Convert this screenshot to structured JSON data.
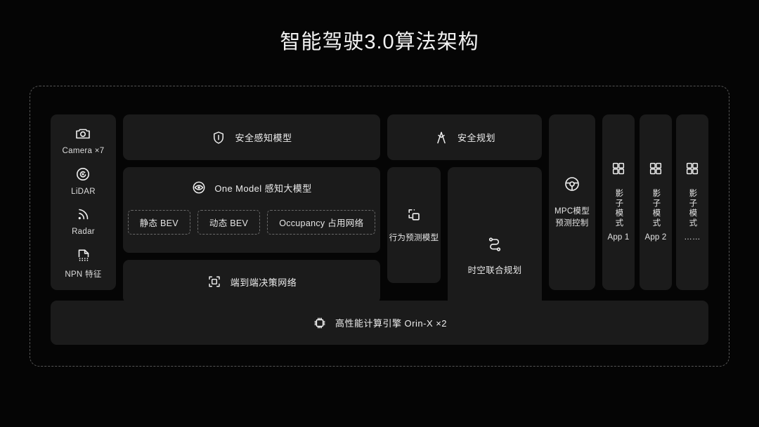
{
  "title": "智能驾驶3.0算法架构",
  "colors": {
    "background": "#050505",
    "card": "#1b1b1b",
    "text": "#ededed",
    "frame_border": "#555555",
    "chip_border": "#6a6a6a"
  },
  "sensors": {
    "name": "sensor-column",
    "items": [
      {
        "icon": "camera-icon",
        "label": "Camera ×7"
      },
      {
        "icon": "lidar-icon",
        "label": "LiDAR"
      },
      {
        "icon": "radar-icon",
        "label": "Radar"
      },
      {
        "icon": "npn-map-icon",
        "label": "NPN 特征"
      }
    ]
  },
  "blocks": {
    "safety_perception": {
      "icon": "shield-icon",
      "label": "安全感知模型"
    },
    "safety_planning": {
      "icon": "person-route-icon",
      "label": "安全规划"
    },
    "one_model": {
      "icon": "eye-icon",
      "label": "One Model 感知大模型",
      "chips": [
        "静态 BEV",
        "动态 BEV",
        "Occupancy 占用网络"
      ]
    },
    "behavior_prediction": {
      "icon": "copy-layers-icon",
      "label": "行为预测模型"
    },
    "spatiotemporal_planning": {
      "icon": "route-path-icon",
      "label": "时空联合规划"
    },
    "end_to_end": {
      "icon": "scan-node-icon",
      "label": "端到端决策网络"
    },
    "mpc": {
      "icon": "steering-wheel-icon",
      "label_line1": "MPC模型",
      "label_line2": "预测控制"
    },
    "shadow_modes": [
      {
        "icon": "grid-apps-icon",
        "label_cn": "影子模式",
        "label_app": "App 1"
      },
      {
        "icon": "grid-apps-icon",
        "label_cn": "影子模式",
        "label_app": "App 2"
      },
      {
        "icon": "grid-apps-icon",
        "label_cn": "影子模式",
        "label_app": "……"
      }
    ],
    "compute_engine": {
      "icon": "chip-icon",
      "label": "高性能计算引擎 Orin-X ×2"
    }
  }
}
